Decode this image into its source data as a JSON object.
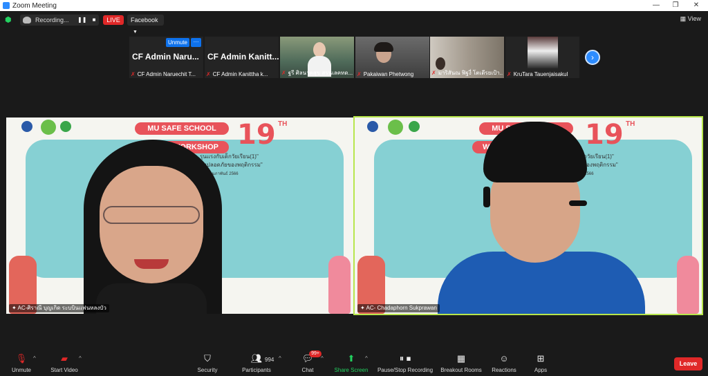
{
  "window": {
    "title": "Zoom Meeting"
  },
  "topbar": {
    "recording_label": "Recording...",
    "live_label": "LIVE",
    "stream_target": "Facebook",
    "view_label": "View"
  },
  "thumbnails": {
    "popover": {
      "unmute_label": "Unmute",
      "more_label": "···"
    },
    "items": [
      {
        "big_name": "CF Admin Naru...",
        "label": "CF Admin Naruechit T..."
      },
      {
        "big_name": "CF Admin Kanitt...",
        "label": "CF Admin Kanittha k..."
      },
      {
        "big_name": "",
        "label": "ฐรี ศิลนาคสุข สรนเลคทด..."
      },
      {
        "big_name": "",
        "label": "Pakaiwan Phetwong"
      },
      {
        "big_name": "",
        "label": "มาริสันณ ฟิฐงี่ โตเดีรยเป้า..."
      },
      {
        "big_name": "",
        "label": "KruTara Tauenjaisakul"
      }
    ]
  },
  "slide": {
    "title_line1": "MU SAFE SCHOOL",
    "title_line2": "WORKSHOP",
    "number": "19",
    "suffix": "TH",
    "subtitle_1": "รุนแรงกับเด็กวัยเรียน(1)\"",
    "subtitle_2": "ามปลอดภัยของพฤติกรรม\"",
    "date": "ที่ 17 กุมภาพันธ์ 2566"
  },
  "tiles": [
    {
      "caption": "AC-ศิราณี บุญเกิด ระบบินแฟนหลงบัว"
    },
    {
      "caption": "AC- Chadaphorn Sukprawan"
    }
  ],
  "toolbar": {
    "unmute": "Unmute",
    "start_video": "Start Video",
    "security": "Security",
    "participants": "Participants",
    "participant_count": "994",
    "chat": "Chat",
    "chat_badge": "99+",
    "share_screen": "Share Screen",
    "recording": "Pause/Stop Recording",
    "breakout": "Breakout Rooms",
    "reactions": "Reactions",
    "apps": "Apps",
    "leave": "Leave"
  },
  "colors": {
    "accent_blue": "#0e72ed",
    "live_red": "#e02828",
    "share_green": "#23d160",
    "active_speaker": "#b7e64b",
    "slide_teal": "#86d0d3",
    "slide_red": "#e8535a"
  }
}
